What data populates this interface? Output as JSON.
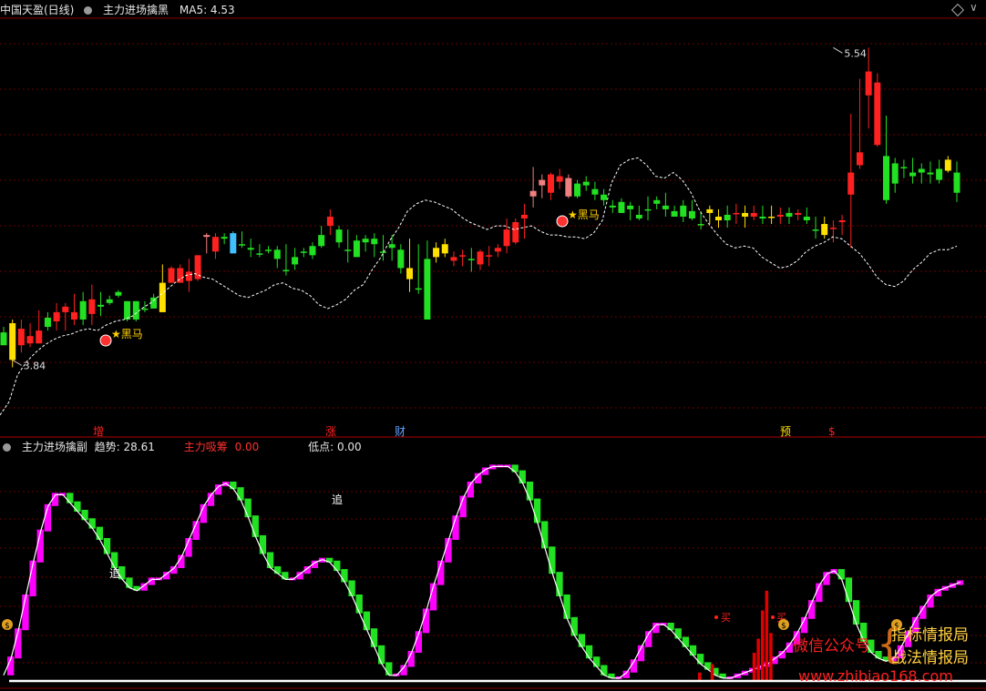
{
  "header": {
    "title": "中国天盈(日线)",
    "indicator": "主力进场擒黑",
    "ma_label": "MA5: 4.53"
  },
  "sub_header": {
    "indicator": "主力进场擒副",
    "trend": "趋势: 28.61",
    "absorb_label": "主力吸筹",
    "absorb_value": "0.00",
    "low": "低点: 0.00"
  },
  "annotations": {
    "high_label": "5.54",
    "low_label": "3.84",
    "signal_text": "黑马",
    "zhui": "追",
    "buy": "买",
    "markers": [
      "增",
      "涨",
      "财",
      "预",
      "$"
    ]
  },
  "watermark": {
    "left": "微信公众号",
    "right1": "指标情报局",
    "right2": "战法情报局",
    "url": "www.zhibiao168.com"
  },
  "colors": {
    "up": "#ff2020",
    "down": "#22e022",
    "yellow": "#ffe000",
    "pink": "#f08080",
    "magenta": "#ff00ff",
    "grid": "#6a0000"
  },
  "chart_data": [
    {
      "type": "candlestick",
      "title": "主力进场擒黑",
      "ylim": [
        3.5,
        5.7
      ],
      "series": [
        {
          "name": "MA5",
          "values": [
            3.54,
            3.61,
            3.76,
            3.83,
            3.88,
            3.92,
            3.95,
            3.97,
            3.98,
            4.0,
            4.01,
            4.0,
            4.03,
            4.05,
            4.06,
            4.08,
            4.12,
            4.15,
            4.19,
            4.23,
            4.27,
            4.3,
            4.31,
            4.29,
            4.28,
            4.25,
            4.22,
            4.19,
            4.18,
            4.2,
            4.22,
            4.25,
            4.26,
            4.23,
            4.22,
            4.19,
            4.14,
            4.12,
            4.14,
            4.17,
            4.22,
            4.25,
            4.33,
            4.4,
            4.49,
            4.56,
            4.65,
            4.69,
            4.71,
            4.7,
            4.68,
            4.66,
            4.62,
            4.59,
            4.57,
            4.55,
            4.57,
            4.57,
            4.55,
            4.56,
            4.57,
            4.54,
            4.52,
            4.52,
            4.51,
            4.51,
            4.5,
            4.53,
            4.6,
            4.8,
            4.9,
            4.93,
            4.94,
            4.9,
            4.84,
            4.83,
            4.86,
            4.82,
            4.75,
            4.65,
            4.58,
            4.52,
            4.47,
            4.45,
            4.46,
            4.45,
            4.4,
            4.37,
            4.34,
            4.35,
            4.38,
            4.43,
            4.46,
            4.48,
            4.51,
            4.5,
            4.46,
            4.42,
            4.36,
            4.29,
            4.25,
            4.24,
            4.27,
            4.33,
            4.37,
            4.42,
            4.44,
            4.44,
            4.46
          ]
        }
      ],
      "candles": [
        [
          3.99,
          4.02,
          3.92,
          3.92,
          "green"
        ],
        [
          3.84,
          4.06,
          3.8,
          4.04,
          "yellow"
        ],
        [
          4.01,
          4.06,
          3.88,
          3.92,
          "red"
        ],
        [
          3.93,
          4.04,
          3.91,
          3.97,
          "red"
        ],
        [
          3.93,
          4.11,
          3.93,
          4.0,
          "red"
        ],
        [
          4.02,
          4.1,
          4.0,
          4.07,
          "green"
        ],
        [
          4.05,
          4.15,
          4.0,
          4.1,
          "red"
        ],
        [
          4.1,
          4.15,
          4.0,
          4.13,
          "red"
        ],
        [
          4.06,
          4.2,
          4.03,
          4.1,
          "red"
        ],
        [
          4.16,
          4.21,
          4.03,
          4.06,
          "green"
        ],
        [
          4.09,
          4.25,
          4.03,
          4.17,
          "red"
        ],
        [
          4.13,
          4.21,
          4.08,
          4.14,
          "green"
        ],
        [
          4.17,
          4.19,
          4.14,
          4.15,
          "green"
        ],
        [
          4.19,
          4.22,
          4.18,
          4.21,
          "green"
        ],
        [
          4.06,
          4.16,
          4.05,
          4.16,
          "green"
        ],
        [
          4.06,
          4.16,
          4.05,
          4.16,
          "green"
        ],
        [
          4.12,
          4.16,
          4.1,
          4.12,
          "green"
        ],
        [
          4.12,
          4.2,
          4.12,
          4.18,
          "green"
        ],
        [
          4.26,
          4.36,
          4.1,
          4.1,
          "yellow"
        ],
        [
          4.26,
          4.35,
          4.26,
          4.34,
          "red"
        ],
        [
          4.26,
          4.36,
          4.26,
          4.34,
          "red"
        ],
        [
          4.27,
          4.39,
          4.21,
          4.32,
          "red"
        ],
        [
          4.28,
          4.41,
          4.27,
          4.41,
          "red"
        ],
        [
          4.51,
          4.53,
          4.42,
          4.52,
          "pink"
        ],
        [
          4.43,
          4.53,
          4.39,
          4.51,
          "red"
        ],
        [
          4.5,
          4.53,
          4.47,
          4.51,
          "green"
        ],
        [
          4.42,
          4.54,
          4.42,
          4.53,
          "cyan"
        ],
        [
          4.47,
          4.54,
          4.45,
          4.47,
          "green"
        ],
        [
          4.44,
          4.5,
          4.4,
          4.45,
          "green"
        ],
        [
          4.42,
          4.47,
          4.4,
          4.42,
          "green"
        ],
        [
          4.44,
          4.46,
          4.42,
          4.44,
          "green"
        ],
        [
          4.39,
          4.46,
          4.34,
          4.44,
          "green"
        ],
        [
          4.33,
          4.47,
          4.3,
          4.33,
          "green"
        ],
        [
          4.36,
          4.45,
          4.33,
          4.4,
          "green"
        ],
        [
          4.43,
          4.45,
          4.4,
          4.43,
          "green"
        ],
        [
          4.46,
          4.48,
          4.39,
          4.41,
          "green"
        ],
        [
          4.52,
          4.57,
          4.45,
          4.46,
          "green"
        ],
        [
          4.62,
          4.66,
          4.52,
          4.57,
          "red"
        ],
        [
          4.55,
          4.57,
          4.45,
          4.48,
          "green"
        ],
        [
          4.44,
          4.55,
          4.37,
          4.44,
          "green"
        ],
        [
          4.49,
          4.52,
          4.4,
          4.4,
          "green"
        ],
        [
          4.5,
          4.52,
          4.43,
          4.48,
          "green"
        ],
        [
          4.5,
          4.53,
          4.4,
          4.47,
          "green"
        ],
        [
          4.43,
          4.52,
          4.38,
          4.43,
          "green"
        ],
        [
          4.45,
          4.52,
          4.38,
          4.47,
          "green"
        ],
        [
          4.44,
          4.47,
          4.31,
          4.34,
          "green"
        ],
        [
          4.28,
          4.5,
          4.21,
          4.34,
          "yellow"
        ],
        [
          4.23,
          4.47,
          4.2,
          4.23,
          "green"
        ],
        [
          4.39,
          4.49,
          4.06,
          4.06,
          "green"
        ],
        [
          4.45,
          4.48,
          4.37,
          4.4,
          "yellow"
        ],
        [
          4.47,
          4.5,
          4.4,
          4.42,
          "yellow"
        ],
        [
          4.38,
          4.43,
          4.35,
          4.4,
          "red"
        ],
        [
          4.41,
          4.44,
          4.35,
          4.41,
          "red"
        ],
        [
          4.39,
          4.45,
          4.32,
          4.39,
          "green"
        ],
        [
          4.36,
          4.44,
          4.33,
          4.43,
          "red"
        ],
        [
          4.41,
          4.46,
          4.35,
          4.41,
          "red"
        ],
        [
          4.45,
          4.47,
          4.4,
          4.43,
          "red"
        ],
        [
          4.55,
          4.61,
          4.42,
          4.46,
          "red"
        ],
        [
          4.48,
          4.61,
          4.47,
          4.59,
          "red"
        ],
        [
          4.63,
          4.69,
          4.5,
          4.61,
          "red"
        ],
        [
          4.76,
          4.89,
          4.67,
          4.73,
          "pink"
        ],
        [
          4.79,
          4.85,
          4.72,
          4.82,
          "pink"
        ],
        [
          4.75,
          4.86,
          4.71,
          4.85,
          "red"
        ],
        [
          4.81,
          4.88,
          4.77,
          4.84,
          "red"
        ],
        [
          4.73,
          4.85,
          4.72,
          4.83,
          "pink"
        ],
        [
          4.8,
          4.82,
          4.72,
          4.73,
          "green"
        ],
        [
          4.79,
          4.84,
          4.76,
          4.81,
          "green"
        ],
        [
          4.77,
          4.81,
          4.71,
          4.74,
          "green"
        ],
        [
          4.74,
          4.77,
          4.68,
          4.71,
          "green"
        ],
        [
          4.68,
          4.71,
          4.64,
          4.67,
          "green"
        ],
        [
          4.7,
          4.72,
          4.64,
          4.64,
          "green"
        ],
        [
          4.66,
          4.7,
          4.6,
          4.68,
          "green"
        ],
        [
          4.61,
          4.68,
          4.6,
          4.63,
          "green"
        ],
        [
          4.66,
          4.73,
          4.6,
          4.66,
          "green"
        ],
        [
          4.69,
          4.73,
          4.66,
          4.71,
          "green"
        ],
        [
          4.68,
          4.75,
          4.62,
          4.66,
          "green"
        ],
        [
          4.62,
          4.68,
          4.62,
          4.65,
          "green"
        ],
        [
          4.62,
          4.71,
          4.59,
          4.68,
          "green"
        ],
        [
          4.65,
          4.71,
          4.6,
          4.61,
          "green"
        ],
        [
          4.58,
          4.65,
          4.55,
          4.58,
          "green"
        ],
        [
          4.64,
          4.68,
          4.58,
          4.66,
          "yellow"
        ],
        [
          4.6,
          4.66,
          4.56,
          4.62,
          "yellow"
        ],
        [
          4.6,
          4.68,
          4.56,
          4.63,
          "green"
        ],
        [
          4.64,
          4.69,
          4.58,
          4.64,
          "red"
        ],
        [
          4.62,
          4.68,
          4.56,
          4.64,
          "yellow"
        ],
        [
          4.62,
          4.68,
          4.6,
          4.64,
          "red"
        ],
        [
          4.61,
          4.68,
          4.58,
          4.62,
          "green"
        ],
        [
          4.62,
          4.68,
          4.58,
          4.62,
          "yellow"
        ],
        [
          4.63,
          4.67,
          4.58,
          4.62,
          "red"
        ],
        [
          4.62,
          4.67,
          4.58,
          4.64,
          "green"
        ],
        [
          4.63,
          4.66,
          4.6,
          4.64,
          "red"
        ],
        [
          4.6,
          4.67,
          4.58,
          4.62,
          "green"
        ],
        [
          4.55,
          4.62,
          4.5,
          4.55,
          "green"
        ],
        [
          4.58,
          4.62,
          4.5,
          4.52,
          "yellow"
        ],
        [
          4.56,
          4.6,
          4.48,
          4.56,
          "red"
        ],
        [
          4.6,
          4.63,
          4.52,
          4.59,
          "red"
        ],
        [
          4.74,
          5.18,
          4.45,
          4.86,
          "red"
        ],
        [
          4.97,
          5.37,
          4.88,
          4.9,
          "red"
        ],
        [
          5.41,
          5.54,
          5.1,
          5.28,
          "red"
        ],
        [
          5.35,
          5.4,
          5.0,
          5.01,
          "red"
        ],
        [
          4.95,
          5.17,
          4.69,
          4.71,
          "green"
        ],
        [
          4.91,
          4.94,
          4.75,
          4.8,
          "green"
        ],
        [
          4.89,
          4.93,
          4.83,
          4.89,
          "green"
        ],
        [
          4.86,
          4.94,
          4.8,
          4.84,
          "green"
        ],
        [
          4.88,
          4.91,
          4.8,
          4.86,
          "green"
        ],
        [
          4.85,
          4.92,
          4.8,
          4.86,
          "green"
        ],
        [
          4.88,
          4.93,
          4.8,
          4.82,
          "green"
        ],
        [
          4.93,
          4.95,
          4.86,
          4.87,
          "yellow"
        ],
        [
          4.86,
          4.92,
          4.7,
          4.75,
          "green"
        ]
      ]
    },
    {
      "type": "bar",
      "title": "主力进场擒副",
      "ylim": [
        0,
        80
      ],
      "series": [
        {
          "name": "趋势",
          "values": [
            2,
            8,
            18,
            30,
            42,
            53,
            62,
            66,
            66,
            63,
            60,
            57,
            54,
            50,
            45,
            40,
            36,
            33,
            32,
            34,
            36,
            36,
            38,
            40,
            44,
            50,
            56,
            62,
            66,
            69,
            70,
            68,
            64,
            58,
            51,
            45,
            40,
            38,
            36,
            36,
            38,
            40,
            42,
            43,
            42,
            39,
            35,
            30,
            24,
            18,
            12,
            6,
            2,
            2,
            5,
            10,
            17,
            25,
            34,
            42,
            50,
            58,
            65,
            70,
            73,
            75,
            76,
            76,
            76,
            74,
            70,
            64,
            56,
            47,
            38,
            30,
            22,
            16,
            12,
            8,
            5,
            2,
            1,
            1,
            3,
            7,
            12,
            17,
            20,
            20,
            18,
            15,
            12,
            9,
            6,
            4,
            2,
            1,
            1,
            2,
            3,
            4,
            5,
            6,
            8,
            10,
            13,
            17,
            22,
            28,
            34,
            38,
            39,
            36,
            28,
            20,
            14,
            10,
            8,
            7,
            8,
            12,
            17,
            22,
            26,
            30,
            32,
            33,
            34,
            35
          ]
        },
        {
          "name": "主力吸筹",
          "values": [
            0,
            0,
            0,
            0,
            0,
            0,
            0,
            0,
            0,
            0,
            3,
            0,
            0,
            6,
            0,
            0,
            0,
            0,
            0,
            0,
            0,
            0,
            0,
            10,
            15,
            25,
            32,
            17,
            0,
            0,
            0
          ]
        }
      ]
    }
  ]
}
